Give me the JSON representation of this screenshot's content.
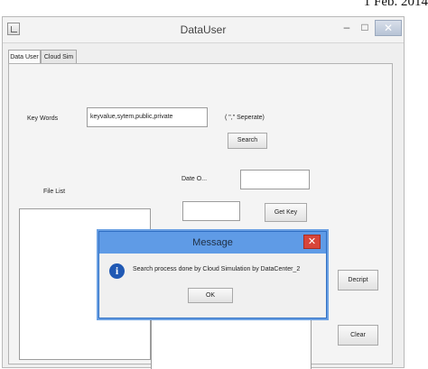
{
  "paper_header": {
    "date": "1 Feb. 2014"
  },
  "window": {
    "title": "DataUser",
    "minimize_glyph": "–",
    "maximize_glyph": "□",
    "close_glyph": "✕"
  },
  "tabs": [
    {
      "label": "Data User",
      "active": true
    },
    {
      "label": "Cloud Sim",
      "active": false
    }
  ],
  "form": {
    "keywords_label": "Key Words",
    "keywords_value": "keyvalue,sytem,public,private",
    "separator_hint": "( \",\" Seperate)",
    "search_button": "Search",
    "date_label": "Date O...",
    "date_value": "",
    "key_value": "",
    "get_key_button": "Get Key",
    "file_list_label": "File List",
    "decrypt_button": "Decript",
    "clear_button": "Clear"
  },
  "dialog": {
    "title": "Message",
    "message": "Search process done by Cloud Simulation by DataCenter_2",
    "ok_button": "OK",
    "close_glyph": "✕",
    "icon": "info-icon"
  },
  "colors": {
    "dialog_titlebar": "#5f9be6",
    "dialog_close": "#d8453a",
    "info_icon": "#2059b4"
  }
}
